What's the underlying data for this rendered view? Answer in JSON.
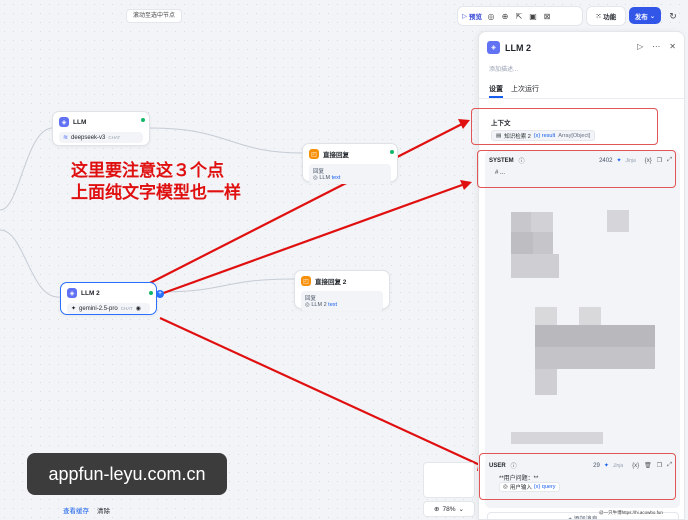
{
  "canvas": {
    "hint": "滚动至选中节点"
  },
  "toolbar": {
    "preview": "预览",
    "features": "功能",
    "publish": "发布"
  },
  "nodes": {
    "llm1": {
      "title": "LLM",
      "model": "deepseek-v3",
      "tag": "CHAT"
    },
    "reply1": {
      "title": "直接回复",
      "body_label": "回复",
      "var_node": "LLM",
      "var_name": "text"
    },
    "llm2": {
      "title": "LLM 2",
      "model": "gemini-2.5-pro",
      "tag": "CHAT"
    },
    "reply2": {
      "title": "直接回复 2",
      "body_label": "回复",
      "var_node": "LLM 2",
      "var_name": "text"
    }
  },
  "annotation": {
    "line1": "这里要注意这３个点",
    "line2": "上面纯文字模型也一样"
  },
  "watermark": "appfun-leyu.com.cn",
  "bottom": {
    "view_cache": "查看缓存",
    "clear": "清除",
    "zoom": "78%"
  },
  "panel": {
    "title": "LLM 2",
    "desc_placeholder": "添加描述...",
    "tabs": [
      "设置",
      "上次运行"
    ],
    "context": {
      "label": "上下文",
      "source": "知识检索 2",
      "var": "{x} result",
      "type": "Array[Object]"
    },
    "system": {
      "label": "SYSTEM",
      "count": "2402",
      "jinja": "Jinja",
      "first_line": "# ..."
    },
    "user": {
      "label": "USER",
      "count": "29",
      "jinja": "Jinja",
      "text": "**用户问题：**",
      "var_source": "用户输入",
      "var_name": "{x} query"
    },
    "add_message": "+ 添加消息",
    "credit": "@一只牛博https://hi.acowbo.fun"
  }
}
